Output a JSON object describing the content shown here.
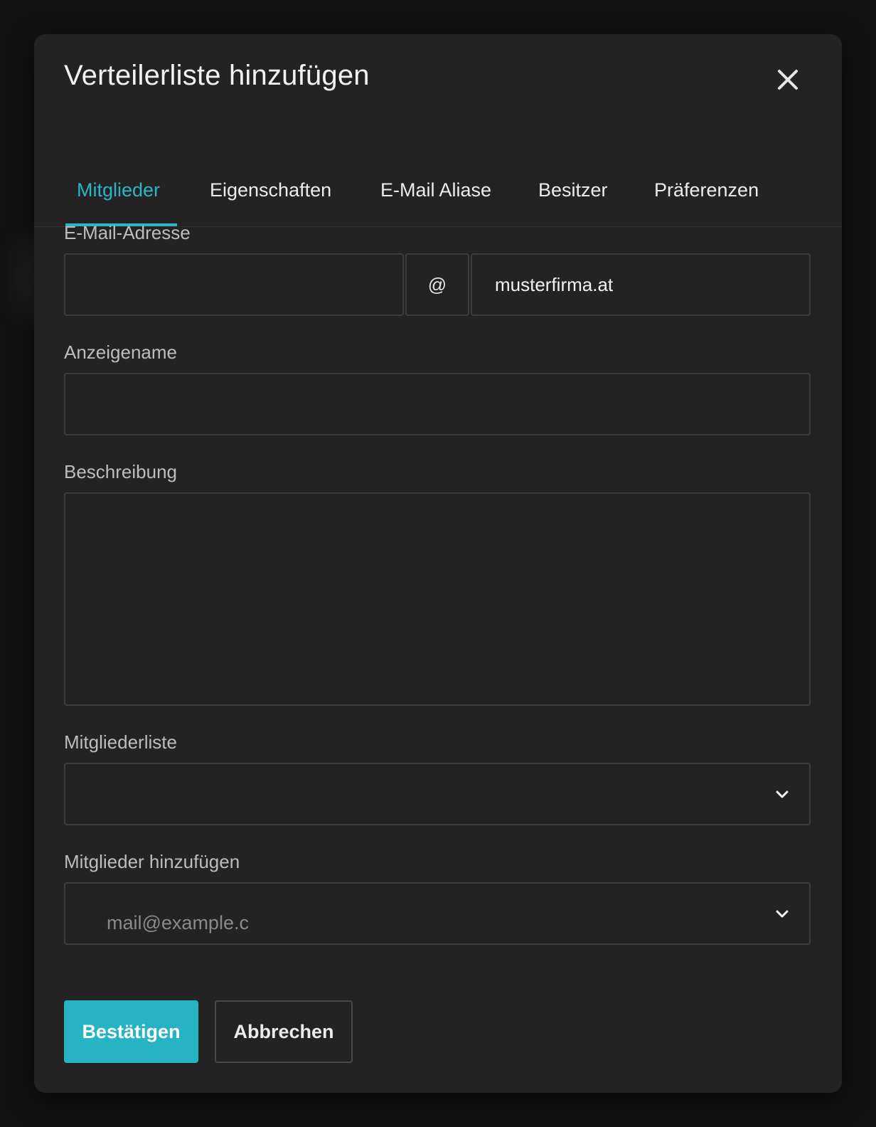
{
  "dialog": {
    "title": "Verteilerliste hinzufügen"
  },
  "tabs": [
    {
      "label": "Mitglieder",
      "active": true
    },
    {
      "label": "Eigenschaften",
      "active": false
    },
    {
      "label": "E-Mail Aliase",
      "active": false
    },
    {
      "label": "Besitzer",
      "active": false
    },
    {
      "label": "Präferenzen",
      "active": false
    }
  ],
  "form": {
    "email": {
      "label": "E-Mail-Adresse",
      "local_value": "",
      "at_symbol": "@",
      "domain_value": "musterfirma.at"
    },
    "display_name": {
      "label": "Anzeigename",
      "value": ""
    },
    "description": {
      "label": "Beschreibung",
      "value": ""
    },
    "member_list": {
      "label": "Mitgliederliste",
      "selected": ""
    },
    "add_members": {
      "label": "Mitglieder hinzufügen",
      "placeholder": "mail@example.com"
    }
  },
  "actions": {
    "confirm_label": "Bestätigen",
    "cancel_label": "Abbrechen"
  },
  "colors": {
    "accent": "#26b3c4",
    "background": "#121212",
    "dialog": "#232323"
  },
  "icons": {
    "close": "close-icon",
    "dropdown": "chevron-down-icon"
  }
}
